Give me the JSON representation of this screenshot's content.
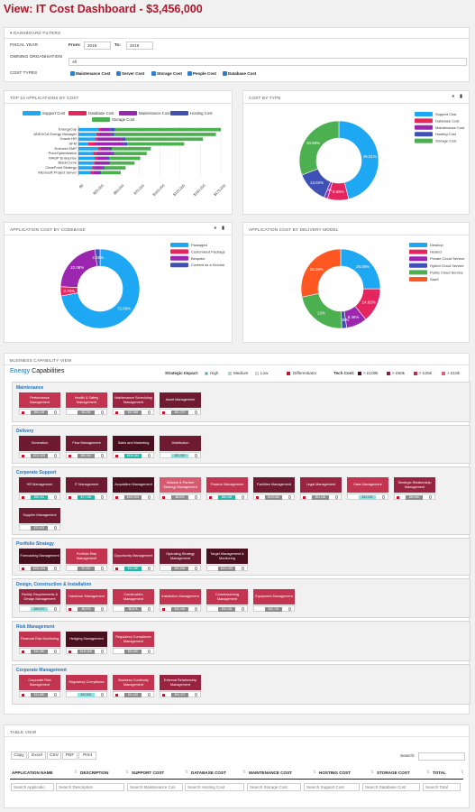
{
  "header": {
    "title": "View: IT Cost Dashboard - $3,456,000"
  },
  "filters": {
    "section_title": "DASHBOARD FILTERS",
    "fiscal_year_label": "FISCAL YEAR",
    "from_label": "From:",
    "from_value": "2018",
    "to_label": "To:",
    "to_value": "2019",
    "owning_org_label": "OWNING ORGANISATION",
    "owning_org_value": "All",
    "cost_types_label": "COST TYPES",
    "cost_types": [
      "Maintenance Cost",
      "Server Cost",
      "Storage Cost",
      "People Cost",
      "Database Cost"
    ]
  },
  "top10": {
    "title": "TOP 10 APPLICATIONS BY COST",
    "legend": [
      {
        "label": "Support Cost",
        "color": "#1ea7f2"
      },
      {
        "label": "Database Cost",
        "color": "#e5265e"
      },
      {
        "label": "Maintenance Cost",
        "color": "#9b27b0"
      },
      {
        "label": "Hosting Cost",
        "color": "#3f51b5"
      },
      {
        "label": "Storage Cost",
        "color": "#4caf50"
      }
    ]
  },
  "cost_by_type": {
    "title": "COST BY TYPE",
    "legend": [
      {
        "label": "Support Cost",
        "color": "#1ea7f2"
      },
      {
        "label": "Database Cost",
        "color": "#e5265e"
      },
      {
        "label": "Maintenance Cost",
        "color": "#9b27b0"
      },
      {
        "label": "Hosting Cost",
        "color": "#3f51b5"
      },
      {
        "label": "Storage Cost",
        "color": "#4caf50"
      }
    ]
  },
  "codebase": {
    "title": "APPLICATION COST BY CODEBASE",
    "legend": [
      {
        "label": "Packaged",
        "color": "#1ea7f2"
      },
      {
        "label": "Customised Package",
        "color": "#e5265e"
      },
      {
        "label": "Bespoke",
        "color": "#9b27b0"
      },
      {
        "label": "Content as a Service",
        "color": "#3f51b5"
      }
    ]
  },
  "delivery": {
    "title": "APPLICATION COST BY DELIVERY MODEL",
    "legend": [
      {
        "label": "Desktop",
        "color": "#1ea7f2"
      },
      {
        "label": "Hosted",
        "color": "#e5265e"
      },
      {
        "label": "Private Cloud Service",
        "color": "#9b27b0"
      },
      {
        "label": "Hybrid Cloud Service",
        "color": "#3f51b5"
      },
      {
        "label": "Public Cloud Service",
        "color": "#4caf50"
      },
      {
        "label": "SaaS",
        "color": "#ff5722"
      }
    ]
  },
  "chart_data": [
    {
      "type": "bar",
      "orientation": "horizontal",
      "stacked": true,
      "title": "TOP 10 APPLICATIONS BY COST",
      "categories": [
        "EnergyCap",
        "ADEXCel Energy Manager",
        "Oracle HR",
        "SFM",
        "Entronix EMP",
        "PriceOptimisation",
        "WASP Enterprise",
        "BlackCurve",
        "ClearPoint Strategy",
        "Microsoft Project Server"
      ],
      "series": [
        {
          "name": "Support Cost",
          "values": [
            25000,
            22000,
            21000,
            12000,
            24000,
            18000,
            20000,
            19000,
            17000,
            15000
          ]
        },
        {
          "name": "Database Cost",
          "values": [
            2000,
            3000,
            2000,
            8000,
            3000,
            4000,
            3000,
            2000,
            2000,
            3000
          ]
        },
        {
          "name": "Maintenance Cost",
          "values": [
            12000,
            15000,
            30000,
            36000,
            10000,
            20000,
            12000,
            16000,
            10000,
            8000
          ]
        },
        {
          "name": "Hosting Cost",
          "values": [
            6000,
            4000,
            5000,
            4000,
            4000,
            2000,
            3000,
            2000,
            3000,
            2000
          ]
        },
        {
          "name": "Storage Cost",
          "values": [
            130000,
            125000,
            95000,
            70000,
            48000,
            40000,
            38000,
            30000,
            26000,
            24000
          ]
        }
      ],
      "xlim": [
        0,
        175000
      ],
      "x_ticks": [
        "$0",
        "$25,000",
        "$50,000",
        "$75,000",
        "$100,000",
        "$125,000",
        "$150,000",
        "$175,000"
      ]
    },
    {
      "type": "pie",
      "title": "COST BY TYPE",
      "slices": [
        {
          "label": "Support Cost",
          "value": 46.01,
          "text": "46.01%"
        },
        {
          "label": "Database Cost",
          "value": 8.65,
          "text": "8.65%"
        },
        {
          "label": "Maintenance Cost",
          "value": 1.4,
          "text": "4%"
        },
        {
          "label": "Hosting Cost",
          "value": 13.02,
          "text": "13.02%"
        },
        {
          "label": "Storage Cost",
          "value": 30.92,
          "text": "30.98%"
        }
      ]
    },
    {
      "type": "pie",
      "title": "APPLICATION COST BY CODEBASE",
      "slices": [
        {
          "label": "Packaged",
          "value": 72.08,
          "text": "72.08%"
        },
        {
          "label": "Customised Package",
          "value": 3.76,
          "text": "3.76%"
        },
        {
          "label": "Bespoke",
          "value": 22.08,
          "text": "22.08%"
        },
        {
          "label": "Content as a Service",
          "value": 2.08,
          "text": "2.08%"
        }
      ]
    },
    {
      "type": "pie",
      "title": "APPLICATION COST BY DELIVERY MODEL",
      "slices": [
        {
          "label": "Desktop",
          "value": 25.08,
          "text": "25.08%"
        },
        {
          "label": "Hosted",
          "value": 14.02,
          "text": "14.02%"
        },
        {
          "label": "Private Cloud Service",
          "value": 8.46,
          "text": "8.46%"
        },
        {
          "label": "Hybrid Cloud Service",
          "value": 2.05,
          "text": "2.05%"
        },
        {
          "label": "Public Cloud Service",
          "value": 22.0,
          "text": "22%"
        },
        {
          "label": "SaaS",
          "value": 28.39,
          "text": "28.39%"
        }
      ]
    }
  ],
  "capability": {
    "section_title": "BUSINESS CAPABILITY VIEW",
    "heading_prefix": "Energy",
    "heading_suffix": " Capabilities",
    "strategic_label": "Strategic Impact:",
    "impact": [
      {
        "label": "High",
        "color": "#2ab3a6"
      },
      {
        "label": "Medium",
        "color": "#8fe0e0"
      },
      {
        "label": "Low",
        "color": "#e8e8e8"
      }
    ],
    "differentiator_label": "Differentiator",
    "tech_cost_label": "Tech Cost:",
    "tech_cost": [
      {
        "label": "> £100k",
        "color": "#4a1020"
      },
      {
        "label": "> £50k",
        "color": "#8e1f3e"
      },
      {
        "label": "> £25k",
        "color": "#c02e4e"
      },
      {
        "label": "> £10k",
        "color": "#e06078"
      }
    ],
    "groups": [
      {
        "title": "Maintenance",
        "items": [
          {
            "name": "Performance Management",
            "value": "$55,328",
            "flag": true,
            "bg": "#c2344f",
            "vbg": "#8c8c8c"
          },
          {
            "name": "Health & Safety Management",
            "value": "$3,258",
            "flag": false,
            "bg": "#c2344f",
            "vbg": "#8c8c8c"
          },
          {
            "name": "Maintenance Scheduling Management",
            "value": "$47,885",
            "flag": true,
            "bg": "#9a2440",
            "vbg": "#8c8c8c"
          },
          {
            "name": "Asset Management",
            "value": "$51,279",
            "flag": true,
            "bg": "#6e1a30",
            "vbg": "#8c8c8c"
          }
        ]
      },
      {
        "title": "Delivery",
        "items": [
          {
            "name": "Generation",
            "value": "$122,928",
            "flag": true,
            "bg": "#6e1a30",
            "vbg": "#8c8c8c"
          },
          {
            "name": "Flow Management",
            "value": "$59,940",
            "flag": true,
            "bg": "#6e1a30",
            "vbg": "#8c8c8c"
          },
          {
            "name": "Sales and Marketing",
            "value": "$436,084",
            "flag": true,
            "bg": "#4a1020",
            "vbg": "#2ab3a6"
          },
          {
            "name": "Distribution",
            "value": "$32,320",
            "flag": false,
            "bg": "#6e1a30",
            "vbg": "#8fe0e0"
          }
        ]
      },
      {
        "title": "Corporate Support",
        "items": [
          {
            "name": "HR Management",
            "value": "$55,341",
            "flag": true,
            "bg": "#6e1a30",
            "vbg": "#2ab3a6"
          },
          {
            "name": "IT Management",
            "value": "$77,435",
            "flag": true,
            "bg": "#6e1a30",
            "vbg": "#2ab3a6"
          },
          {
            "name": "Acquisition Management",
            "value": "$102,903",
            "flag": true,
            "bg": "#4a1020",
            "vbg": "#8c8c8c"
          },
          {
            "name": "Alliance & Partner Strategy Management",
            "value": "$8,875",
            "flag": true,
            "bg": "#d65a70",
            "vbg": "#8c8c8c"
          },
          {
            "name": "Finance Management",
            "value": "$86,638",
            "flag": true,
            "bg": "#c2344f",
            "vbg": "#2ab3a6"
          },
          {
            "name": "Facilities Management",
            "value": "$110,050",
            "flag": true,
            "bg": "#6e1a30",
            "vbg": "#8c8c8c"
          },
          {
            "name": "Legal Management",
            "value": "$91,154",
            "flag": true,
            "bg": "#9a2440",
            "vbg": "#8c8c8c"
          },
          {
            "name": "Data Management",
            "value": "$44,305",
            "flag": false,
            "bg": "#c2344f",
            "vbg": "#8fe0e0"
          },
          {
            "name": "Strategic Relationship Management",
            "value": "$35,540",
            "flag": true,
            "bg": "#9a2440",
            "vbg": "#8c8c8c"
          },
          {
            "name": "Supplier Management",
            "value": "$70,675",
            "flag": false,
            "bg": "#6e1a30",
            "vbg": "#8c8c8c"
          }
        ]
      },
      {
        "title": "Portfolio Strategy",
        "items": [
          {
            "name": "Forecasting Management",
            "value": "$102,404",
            "flag": true,
            "bg": "#4a1020",
            "vbg": "#8c8c8c"
          },
          {
            "name": "Portfolio Risk Management",
            "value": "$7,322",
            "flag": false,
            "bg": "#c2344f",
            "vbg": "#8c8c8c"
          },
          {
            "name": "Opportunity Management",
            "value": "$12,350",
            "flag": true,
            "bg": "#9a2440",
            "vbg": "#2ab3a6"
          },
          {
            "name": "Operating Strategy Management",
            "value": "$30,536",
            "flag": false,
            "bg": "#6e1a30",
            "vbg": "#8c8c8c"
          },
          {
            "name": "Target Management & Monitoring",
            "value": "$101,492",
            "flag": false,
            "bg": "#4a1020",
            "vbg": "#8c8c8c"
          }
        ]
      },
      {
        "title": "Design, Construction & Installation",
        "items": [
          {
            "name": "Facility Requirements & Design Management",
            "value": "$48,670",
            "flag": false,
            "bg": "#9a2440",
            "vbg": "#8fe0e0"
          },
          {
            "name": "Handover Management",
            "value": "$8,875",
            "flag": true,
            "bg": "#c2344f",
            "vbg": "#8c8c8c"
          },
          {
            "name": "Construction Management",
            "value": "$8,875",
            "flag": false,
            "bg": "#c2344f",
            "vbg": "#8c8c8c"
          },
          {
            "name": "Installation Management",
            "value": "$12,435",
            "flag": true,
            "bg": "#c2344f",
            "vbg": "#8c8c8c"
          },
          {
            "name": "Commissioning Management",
            "value": "$10,435",
            "flag": false,
            "bg": "#c2344f",
            "vbg": "#8c8c8c"
          },
          {
            "name": "Equipment Management",
            "value": "$10,720",
            "flag": false,
            "bg": "#c2344f",
            "vbg": "#8c8c8c"
          }
        ]
      },
      {
        "title": "Risk Management",
        "items": [
          {
            "name": "Financial Risk Monitoring",
            "value": "$10,380",
            "flag": true,
            "bg": "#c2344f",
            "vbg": "#8c8c8c"
          },
          {
            "name": "Hedging Management",
            "value": "$140,500",
            "flag": true,
            "bg": "#4a1020",
            "vbg": "#8c8c8c"
          },
          {
            "name": "Regulatory Compliance Management",
            "value": "$32,800",
            "flag": false,
            "bg": "#c2344f",
            "vbg": "#8c8c8c"
          }
        ]
      },
      {
        "title": "Corporate Management",
        "items": [
          {
            "name": "Corporate Risk Management",
            "value": "$13,880",
            "flag": true,
            "bg": "#c2344f",
            "vbg": "#8c8c8c"
          },
          {
            "name": "Regulatory Compliance",
            "value": "$32,800",
            "flag": false,
            "bg": "#c2344f",
            "vbg": "#8fe0e0"
          },
          {
            "name": "Business Continuity Management",
            "value": "$11,420",
            "flag": true,
            "bg": "#c2344f",
            "vbg": "#8c8c8c"
          },
          {
            "name": "External Relationship Management",
            "value": "$94,373",
            "flag": true,
            "bg": "#9a2440",
            "vbg": "#8c8c8c"
          }
        ]
      }
    ]
  },
  "table_view": {
    "section_title": "TABLE VIEW",
    "buttons": [
      "Copy",
      "Excel",
      "CSV",
      "PDF",
      "Print"
    ],
    "search_label": "Search:",
    "columns": [
      "APPLICATION NAME",
      "DESCRIPTION",
      "SUPPORT COST",
      "DATABASE COST",
      "MAINTENANCE COST",
      "HOSTING COST",
      "STORAGE COST",
      "TOTAL"
    ],
    "search_placeholders": [
      "Search Applicatio",
      "Search Description",
      "Search Maintenance Cos",
      "Search Hosting Cost",
      "Search Storage Cost",
      "Search Support Cost",
      "Search Database Cost",
      "Search Total"
    ]
  }
}
